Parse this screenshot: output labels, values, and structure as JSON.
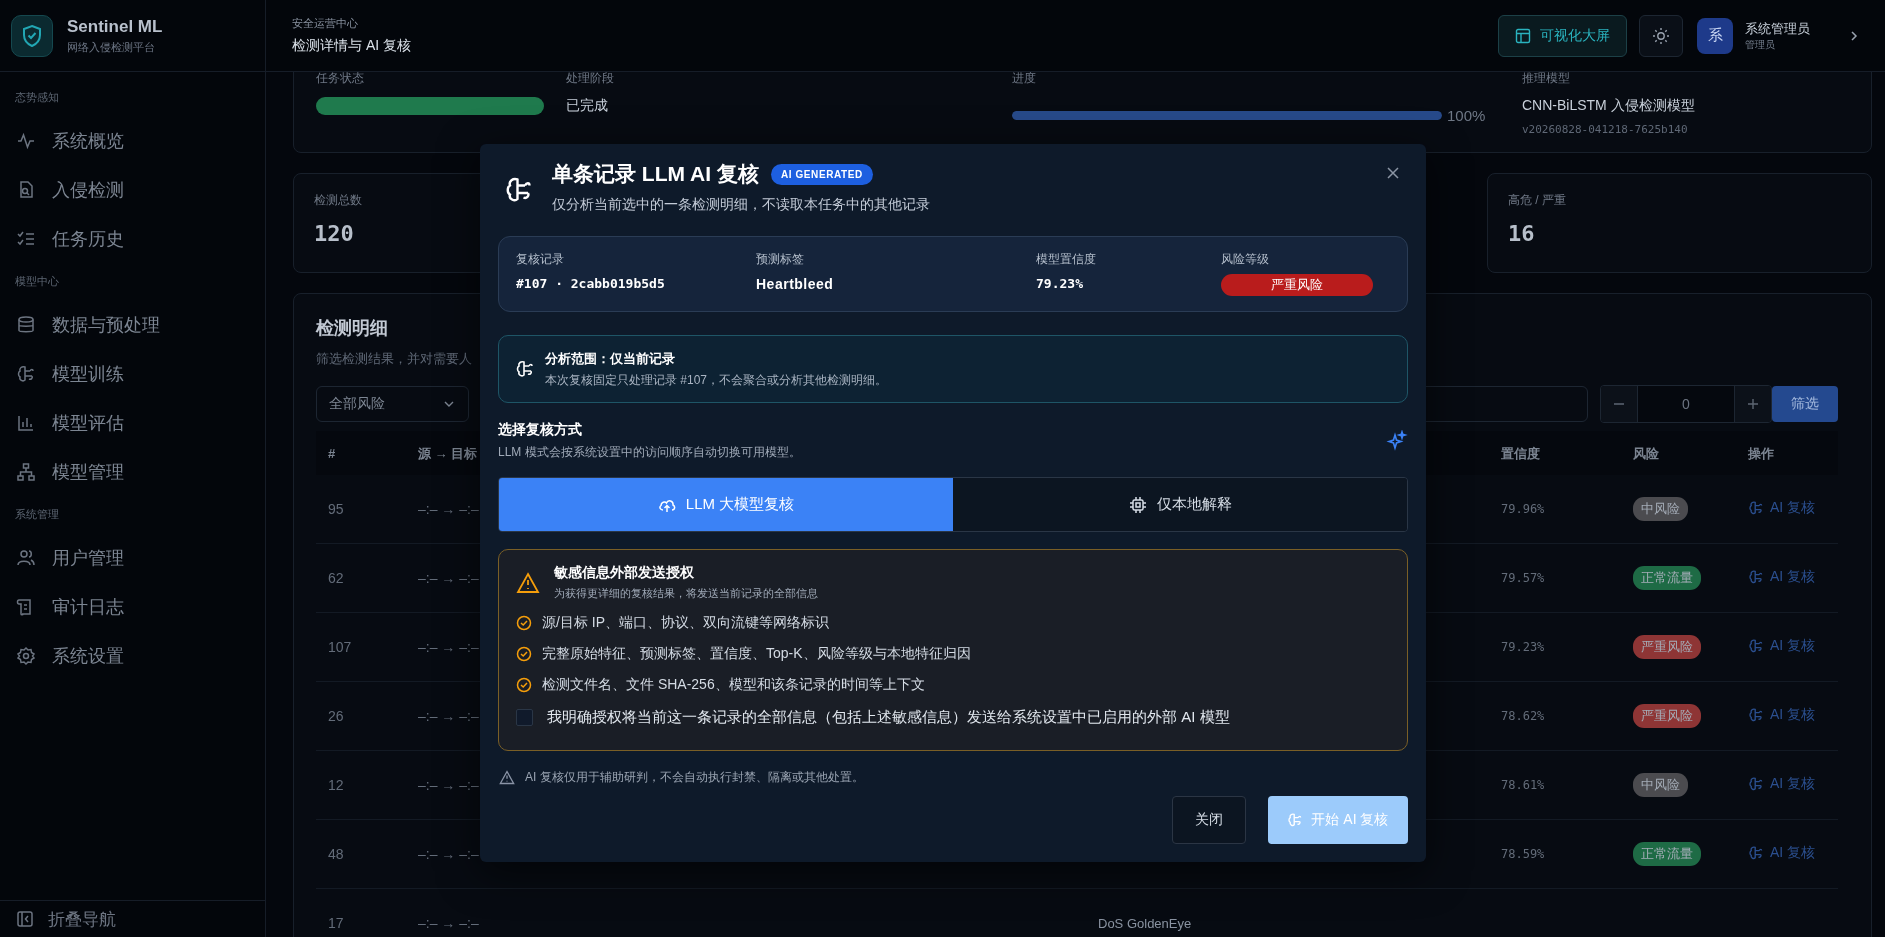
{
  "sidebar": {
    "brand": {
      "name": "Sentinel ML",
      "subtitle": "网络入侵检测平台"
    },
    "sections": [
      {
        "title": "态势感知",
        "items": [
          {
            "label": "系统概览",
            "kind": "activity",
            "selected": false
          },
          {
            "label": "入侵检测",
            "kind": "file-search",
            "selected": false
          },
          {
            "label": "任务历史",
            "kind": "list-check",
            "selected": false
          }
        ]
      },
      {
        "title": "模型中心",
        "items": [
          {
            "label": "数据与预处理",
            "kind": "database",
            "selected": false
          },
          {
            "label": "模型训练",
            "kind": "brain",
            "selected": false
          },
          {
            "label": "模型评估",
            "kind": "bars",
            "selected": false
          },
          {
            "label": "模型管理",
            "kind": "network",
            "selected": false
          }
        ]
      },
      {
        "title": "系统管理",
        "items": [
          {
            "label": "用户管理",
            "kind": "users",
            "selected": false
          },
          {
            "label": "审计日志",
            "kind": "scroll",
            "selected": false
          },
          {
            "label": "系统设置",
            "kind": "gear",
            "selected": false
          }
        ]
      }
    ],
    "collapse_label": "折叠导航"
  },
  "topbar": {
    "breadcrumb": "安全运营中心",
    "title": "检测详情与 AI 复核",
    "screen_button": "可视化大屏",
    "user": {
      "avatar": "系",
      "name": "系统管理员",
      "role": "管理员"
    }
  },
  "task": {
    "status_label": "任务状态",
    "stage_label": "处理阶段",
    "stage": "已完成",
    "progress_label": "进度",
    "progress": {
      "level": 1,
      "reading": "100%"
    },
    "model_label": "推理模型",
    "model": "CNN-BiLSTM 入侵检测模型",
    "version": "v20260828-041218-7625b140"
  },
  "stats": [
    {
      "label": "检测总数",
      "value": "120"
    },
    {
      "label": "高危 / 严重",
      "value": "16"
    }
  ],
  "detail": {
    "title": "检测明细",
    "subtitle": "筛选检测结果，并对需要人",
    "risk_filter": "全部风险",
    "stepper_value": "0",
    "filter_button": "筛选",
    "columns": [
      "#",
      "源 → 目标",
      "置信度",
      "风险",
      "操作"
    ],
    "rows": [
      {
        "index": "95",
        "route": "–:– → –:–",
        "confidence": "79.96%",
        "risk": "中风险",
        "color": "#4b4b4f",
        "action": "AI 复核"
      },
      {
        "index": "62",
        "route": "–:– → –:–",
        "confidence": "79.57%",
        "risk": "正常流量",
        "color": "#1e6b45",
        "action": "AI 复核"
      },
      {
        "index": "107",
        "route": "–:– → –:–",
        "confidence": "79.23%",
        "risk": "严重风险",
        "color": "#8e3535",
        "action": "AI 复核"
      },
      {
        "index": "26",
        "route": "–:– → –:–",
        "confidence": "78.62%",
        "risk": "严重风险",
        "color": "#8e3535",
        "action": "AI 复核"
      },
      {
        "index": "12",
        "route": "–:– → –:–",
        "confidence": "78.61%",
        "risk": "中风险",
        "color": "#4b4b4f",
        "action": "AI 复核"
      },
      {
        "index": "48",
        "route": "–:– → –:–",
        "confidence": "78.59%",
        "risk": "正常流量",
        "color": "#1e6b45",
        "action": "AI 复核"
      },
      {
        "index": "17",
        "route": "–:– → –:–",
        "column_3": "DoS GoldenEye"
      }
    ]
  },
  "modal": {
    "title": "单条记录 LLM AI 复核",
    "badge": "AI GENERATED",
    "subtitle": "仅分析当前选中的一条检测明细，不读取本任务中的其他记录",
    "record": [
      {
        "label": "复核记录",
        "value": "#107 · 2cabb019b5d5",
        "kind": "mono"
      },
      {
        "label": "预测标签",
        "value": "Heartbleed",
        "kind": "strong"
      },
      {
        "label": "模型置信度",
        "value": "79.23%",
        "kind": "mono"
      },
      {
        "label": "风险等级",
        "value": "严重风险",
        "kind": "badge"
      }
    ],
    "scope": {
      "title": "分析范围：仅当前记录",
      "text": "本次复核固定只处理记录 #107，不会聚合或分析其他检测明细。"
    },
    "mode": {
      "title": "选择复核方式",
      "hint": "LLM 模式会按系统设置中的访问顺序自动切换可用模型。",
      "options": [
        {
          "label": "LLM 大模型复核",
          "kind": "cloud",
          "selected": true
        },
        {
          "label": "仅本地解释",
          "kind": "chip",
          "selected": false
        }
      ]
    },
    "consent": {
      "title": "敏感信息外部发送授权",
      "subtitle": "为获得更详细的复核结果，将发送当前记录的全部信息",
      "items": [
        "源/目标 IP、端口、协议、双向流键等网络标识",
        "完整原始特征、预测标签、置信度、Top-K、风险等级与本地特征归因",
        "检测文件名、文件 SHA-256、模型和该条记录的时间等上下文"
      ],
      "checkbox": {
        "label": "我明确授权将当前这一条记录的全部信息（包括上述敏感信息）发送给系统设置中已启用的外部 AI 模型",
        "checked": false
      }
    },
    "note": "AI 复核仅用于辅助研判，不会自动执行封禁、隔离或其他处置。",
    "buttons": [
      {
        "label": "关闭",
        "kind": "secondary",
        "disabled": false
      },
      {
        "label": "开始 AI 复核",
        "kind": "primary",
        "disabled": true
      }
    ]
  }
}
